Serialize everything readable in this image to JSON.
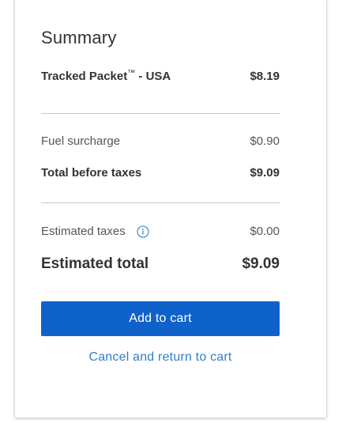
{
  "summary": {
    "title": "Summary",
    "service": {
      "name_prefix": "Tracked Packet",
      "trademark": "™",
      "name_suffix": " - USA",
      "price": "$8.19"
    },
    "fuel_surcharge": {
      "label": "Fuel surcharge",
      "value": "$0.90"
    },
    "total_before_taxes": {
      "label": "Total before taxes",
      "value": "$9.09"
    },
    "estimated_taxes": {
      "label": "Estimated taxes",
      "value": "$0.00",
      "icon": "info-icon"
    },
    "estimated_total": {
      "label": "Estimated total",
      "value": "$9.09"
    }
  },
  "actions": {
    "add_to_cart": "Add to cart",
    "cancel": "Cancel and return to cart"
  },
  "colors": {
    "primary": "#0f62c9",
    "link": "#2f7fc9",
    "text": "#333333",
    "divider": "#c8c8c8"
  }
}
